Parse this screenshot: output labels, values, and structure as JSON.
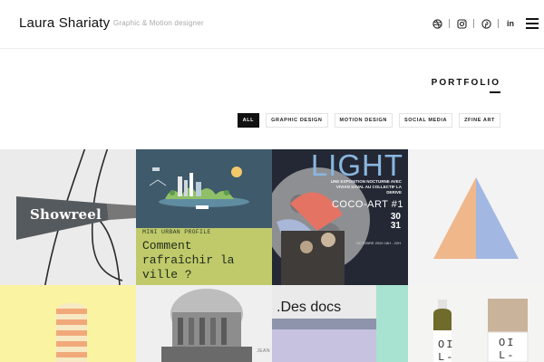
{
  "header": {
    "brand": "Laura Shariaty",
    "tagline": "Graphic & Motion designer",
    "social_icons": [
      "dribbble-icon",
      "instagram-icon",
      "pinterest-icon",
      "linkedin-icon"
    ],
    "social_labels": [
      "in"
    ],
    "menu_icon": "hamburger-menu-icon"
  },
  "portfolio": {
    "title": "PORTFOLIO",
    "filters": [
      "ALL",
      "GRAPHIC DESIGN",
      "MOTION DESIGN",
      "SOCIAL MEDIA",
      "ZFINE ART"
    ],
    "active_filter": "ALL"
  },
  "tiles": {
    "showreel": {
      "label": "Showreel"
    },
    "urban": {
      "small": "MINI URBAN PROFILE",
      "big": "Comment rafraîchir la ville ?"
    },
    "light": {
      "title": "LIGHT",
      "subtitle": "UNE EXPOSITION NOCTURNE AVEC VIVIAN SAVAL AU COLLECTIF LA DERIVE",
      "event": "COCO-ART #1",
      "date_line1": "30",
      "date_line2": "31",
      "date_sub": "OCTOBRE 2020 18H - 22H"
    },
    "jean": {
      "label": "JEAN"
    },
    "docs": {
      "title": ".Des docs"
    },
    "oil": {
      "left": "OI L-",
      "right": "OI L-"
    }
  },
  "colors": {
    "accent_dark": "#111111",
    "urban_green": "#c0ca6b",
    "light_blue": "#89b6df",
    "triangle_orange": "#f0b78b",
    "triangle_blue": "#a3b7e3",
    "stripe_orange": "#f1a97a",
    "yellow_bg": "#faf3a2",
    "mint": "#a8e2d0"
  }
}
